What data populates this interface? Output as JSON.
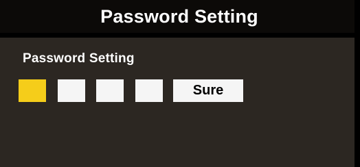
{
  "header": {
    "title": "Password Setting"
  },
  "form": {
    "label": "Password Setting",
    "digits": [
      "",
      "",
      "",
      ""
    ],
    "focused_index": 0,
    "confirm_label": "Sure"
  },
  "colors": {
    "background": "#000000",
    "title_bar": "#0c0a08",
    "panel": "#2c2722",
    "focus": "#f5cd1a",
    "box": "#f5f5f5",
    "text": "#ffffff"
  }
}
